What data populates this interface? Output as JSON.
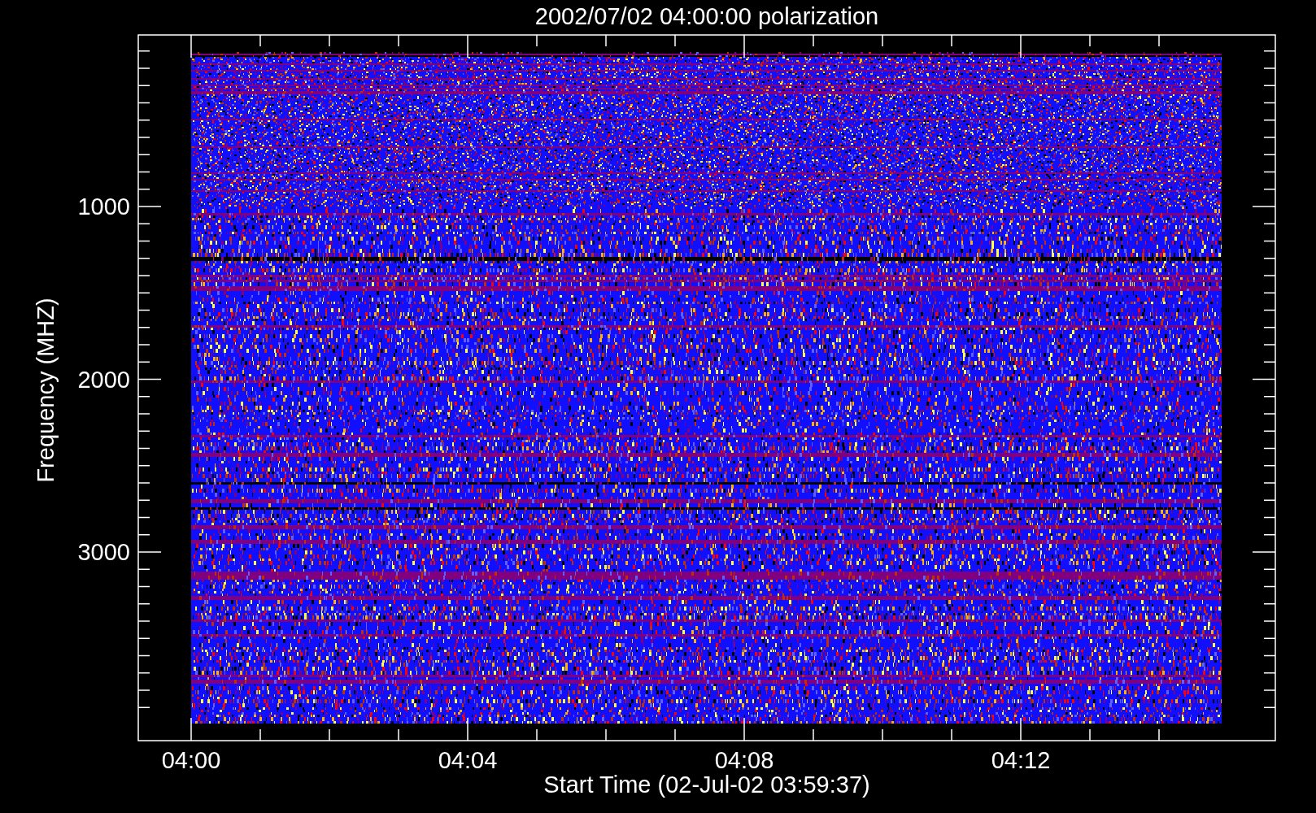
{
  "plot": {
    "title": "2002/07/02 04:00:00 polarization",
    "ylabel": "Frequency (MHZ)",
    "xlabel": "Start Time (02-Jul-02 03:59:37)",
    "yticks": [
      "1000",
      "2000",
      "3000"
    ],
    "xticks": [
      "04:00",
      "04:04",
      "04:08",
      "04:12"
    ]
  }
}
